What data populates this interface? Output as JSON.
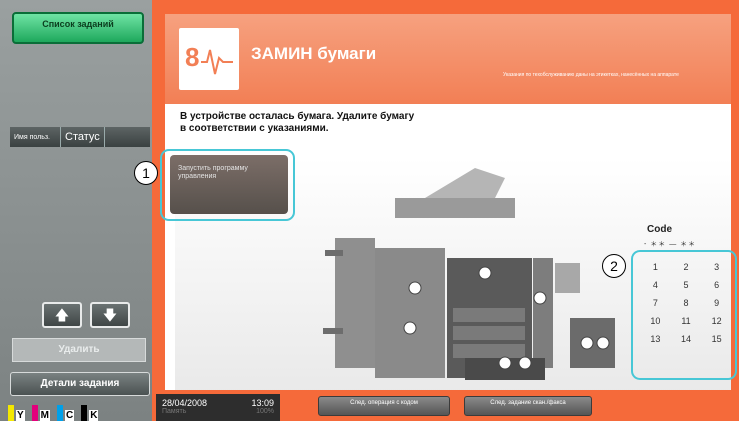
{
  "left_panel": {
    "job_list_label": "Список заданий",
    "user_col": "Имя польз.",
    "status_col": "Статус",
    "up_glyph": "🡅",
    "down_glyph": "🡇",
    "delete_label": "Удалить",
    "job_details_label": "Детали задания",
    "toner": [
      {
        "label": "Y",
        "color": "#f4e800"
      },
      {
        "label": "M",
        "color": "#e3007c"
      },
      {
        "label": "C",
        "color": "#00a0e9"
      },
      {
        "label": "K",
        "color": "#000000"
      }
    ]
  },
  "main": {
    "title": "ЗАМИН бумаги",
    "header_note": "Указания по техобслуживанию даны на этикетках, нанесённых на аппарате",
    "instruction_line1": "В устройстве осталась бумага. Удалите бумагу",
    "instruction_line2": "в соответствии с указаниями.",
    "start_guide_label": "Запустить программу управления",
    "code_title": "Code",
    "code_dashes": "- ＊＊ ― ＊＊",
    "code_numbers": [
      "1",
      "2",
      "3",
      "4",
      "5",
      "6",
      "7",
      "8",
      "9",
      "10",
      "11",
      "12",
      "13",
      "14",
      "15"
    ],
    "callout_1": "1",
    "callout_2": "2"
  },
  "bottom": {
    "date": "28/04/2008",
    "time": "13:09",
    "faint_left": "Память",
    "faint_right": "100%",
    "next_op_label": "След. операция с кодом",
    "next_job_label": "След. задание скан./факса"
  },
  "colors": {
    "accent_orange": "#f56a3a",
    "highlight_teal": "#47c7d6",
    "job_list_green": "#1ea85c"
  }
}
